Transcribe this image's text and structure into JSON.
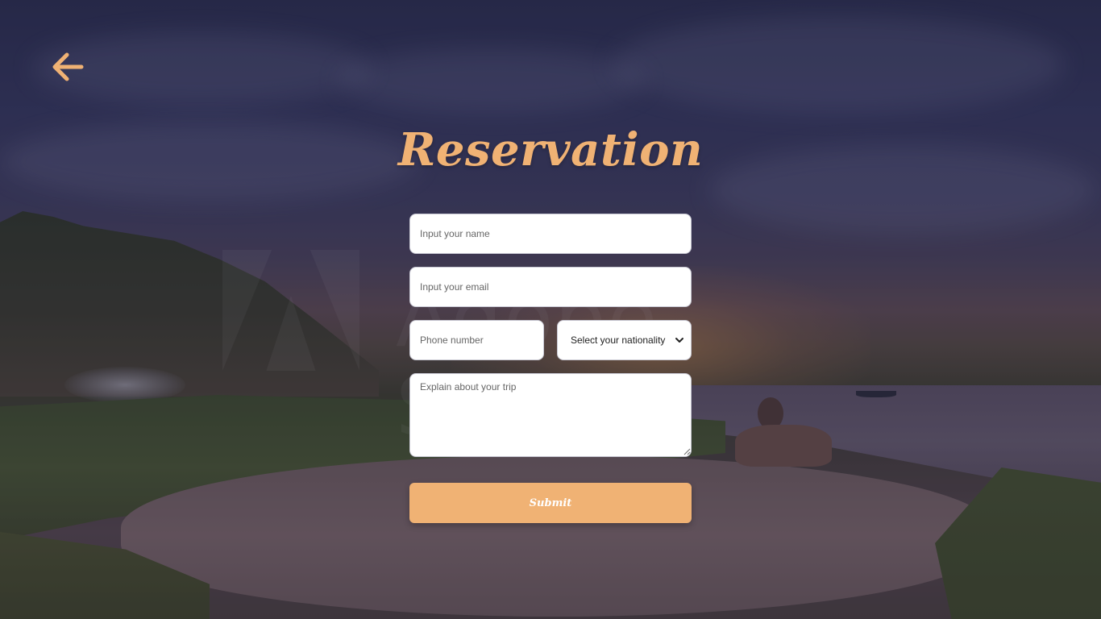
{
  "page": {
    "title": "Reservation",
    "accent_color": "#f0b274"
  },
  "nav": {
    "back_icon": "arrow-left-icon"
  },
  "form": {
    "name": {
      "placeholder": "Input your name",
      "value": ""
    },
    "email": {
      "placeholder": "Input your email",
      "value": ""
    },
    "phone": {
      "placeholder": "Phone number",
      "value": ""
    },
    "nationality": {
      "selected": "Select your nationality",
      "icon": "chevron-down-icon"
    },
    "trip": {
      "placeholder": "Explain about your trip",
      "value": ""
    },
    "submit_label": "Submit"
  },
  "background": {
    "watermark_text": "Adobe Stock"
  }
}
